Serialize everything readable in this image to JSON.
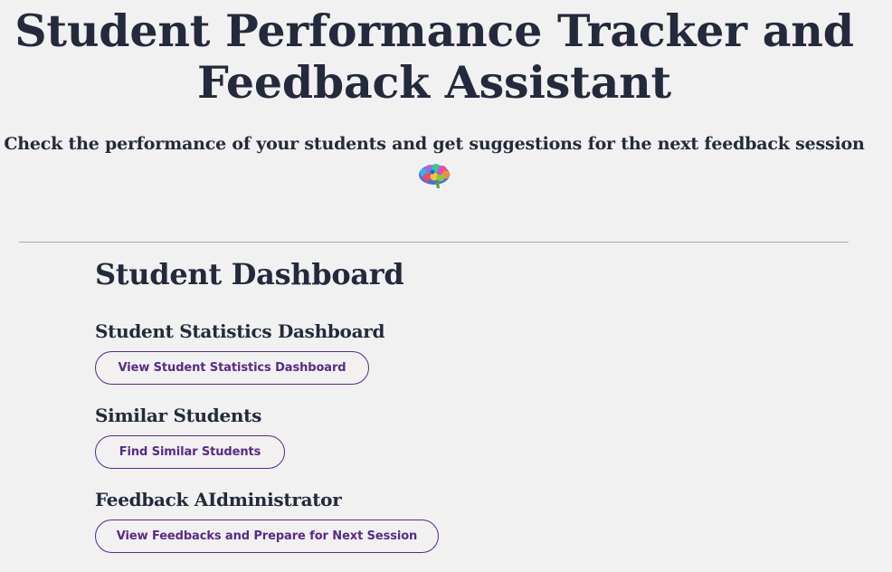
{
  "header": {
    "title_line1": "Student Performance Tracker and",
    "title_line2": "Feedback Assistant",
    "subtitle": "Check the performance of your students and get suggestions for the next feedback session",
    "icon": "brain-icon"
  },
  "dashboard": {
    "heading": "Student Dashboard",
    "sections": [
      {
        "title": "Student Statistics Dashboard",
        "button_label": "View Student Statistics Dashboard"
      },
      {
        "title": "Similar Students",
        "button_label": "Find Similar Students"
      },
      {
        "title": "Feedback AIdministrator",
        "button_label": "View Feedbacks and Prepare for Next Session"
      }
    ]
  },
  "colors": {
    "background": "#f1f1f2",
    "text": "#232a3b",
    "accent": "#5a2a82",
    "divider": "#a8a9b6"
  }
}
